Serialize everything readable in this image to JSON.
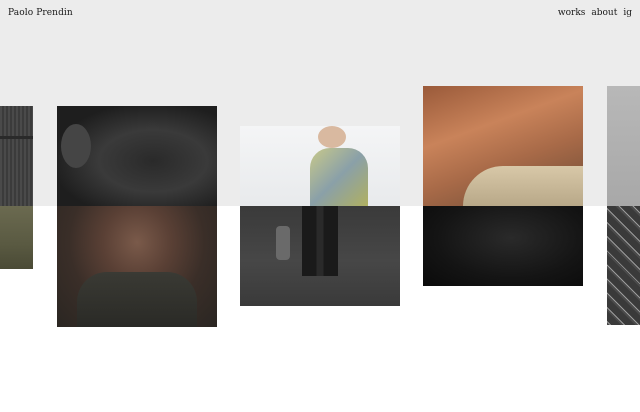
{
  "header": {
    "site_title": "Paolo Prendin",
    "nav": [
      {
        "label": "works"
      },
      {
        "label": "about"
      },
      {
        "label": "ig"
      }
    ]
  },
  "colors": {
    "top_band": "#ececec",
    "background": "#ffffff",
    "text": "#1a1a1a"
  },
  "gallery": {
    "items": [
      {
        "name": "gallery-photo-partial-left"
      },
      {
        "name": "gallery-photo-portrait-man"
      },
      {
        "name": "gallery-photo-figure-street"
      },
      {
        "name": "gallery-photo-skin-black"
      },
      {
        "name": "gallery-photo-partial-right"
      }
    ]
  }
}
